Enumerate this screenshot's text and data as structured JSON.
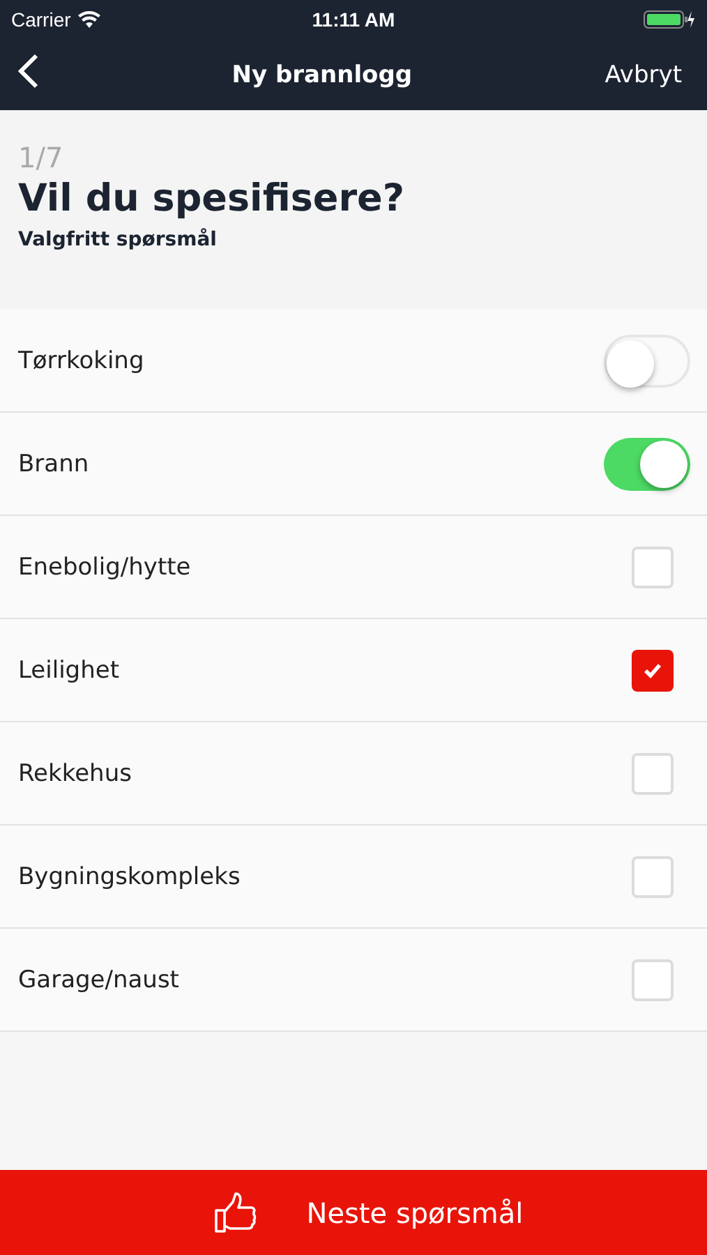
{
  "status_bar": {
    "carrier": "Carrier",
    "time": "11:11 AM"
  },
  "nav": {
    "title": "Ny brannlogg",
    "cancel": "Avbryt"
  },
  "header": {
    "step": "1/7",
    "question": "Vil du spesifisere?",
    "hint": "Valgfritt spørsmål"
  },
  "options": [
    {
      "label": "Tørrkoking",
      "kind": "toggle",
      "on": false
    },
    {
      "label": "Brann",
      "kind": "toggle",
      "on": true
    },
    {
      "label": "Enebolig/hytte",
      "kind": "checkbox",
      "checked": false
    },
    {
      "label": "Leilighet",
      "kind": "checkbox",
      "checked": true
    },
    {
      "label": "Rekkehus",
      "kind": "checkbox",
      "checked": false
    },
    {
      "label": "Bygningskompleks",
      "kind": "checkbox",
      "checked": false
    },
    {
      "label": "Garage/naust",
      "kind": "checkbox",
      "checked": false
    }
  ],
  "next_button": {
    "label": "Neste spørsmål"
  }
}
